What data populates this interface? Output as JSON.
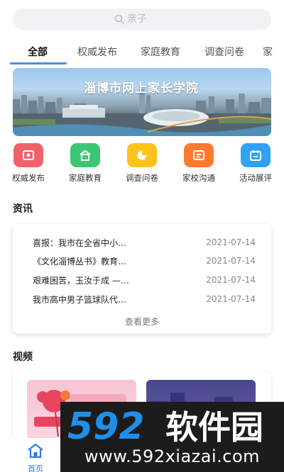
{
  "search": {
    "placeholder": "亲子"
  },
  "tabs": [
    {
      "label": "全部",
      "active": true
    },
    {
      "label": "权威发布"
    },
    {
      "label": "家庭教育"
    },
    {
      "label": "调查问卷"
    },
    {
      "label": "家"
    }
  ],
  "banner": {
    "title": "淄博市网上家长学院"
  },
  "quick_menu": [
    {
      "label": "权威发布",
      "color": "#f0626b",
      "icon": "badge-icon"
    },
    {
      "label": "家庭教育",
      "color": "#3cc872",
      "icon": "home-icon"
    },
    {
      "label": "调查问卷",
      "color": "#ffc21a",
      "icon": "pie-chart-icon"
    },
    {
      "label": "家校沟通",
      "color": "#ff7a2f",
      "icon": "message-icon"
    },
    {
      "label": "活动展评",
      "color": "#2fa2f5",
      "icon": "calendar-icon"
    }
  ],
  "news": {
    "section_title": "资讯",
    "items": [
      {
        "title": "喜报：我市在全省中小…",
        "date": "2021-07-14"
      },
      {
        "title": "《文化淄博丛书》教育…",
        "date": "2021-07-14"
      },
      {
        "title": "艰难困苦，玉汝于成 —…",
        "date": "2021-07-14"
      },
      {
        "title": "我市高中男子篮球队代…",
        "date": "2021-07-14"
      }
    ],
    "more_label": "查看更多"
  },
  "videos": {
    "section_title": "视频"
  },
  "bottom_nav": {
    "home_label": "首页",
    "accent": "#2f7be6"
  },
  "watermark": {
    "brand": "592软件园",
    "url": "www.592xiazai.com"
  }
}
